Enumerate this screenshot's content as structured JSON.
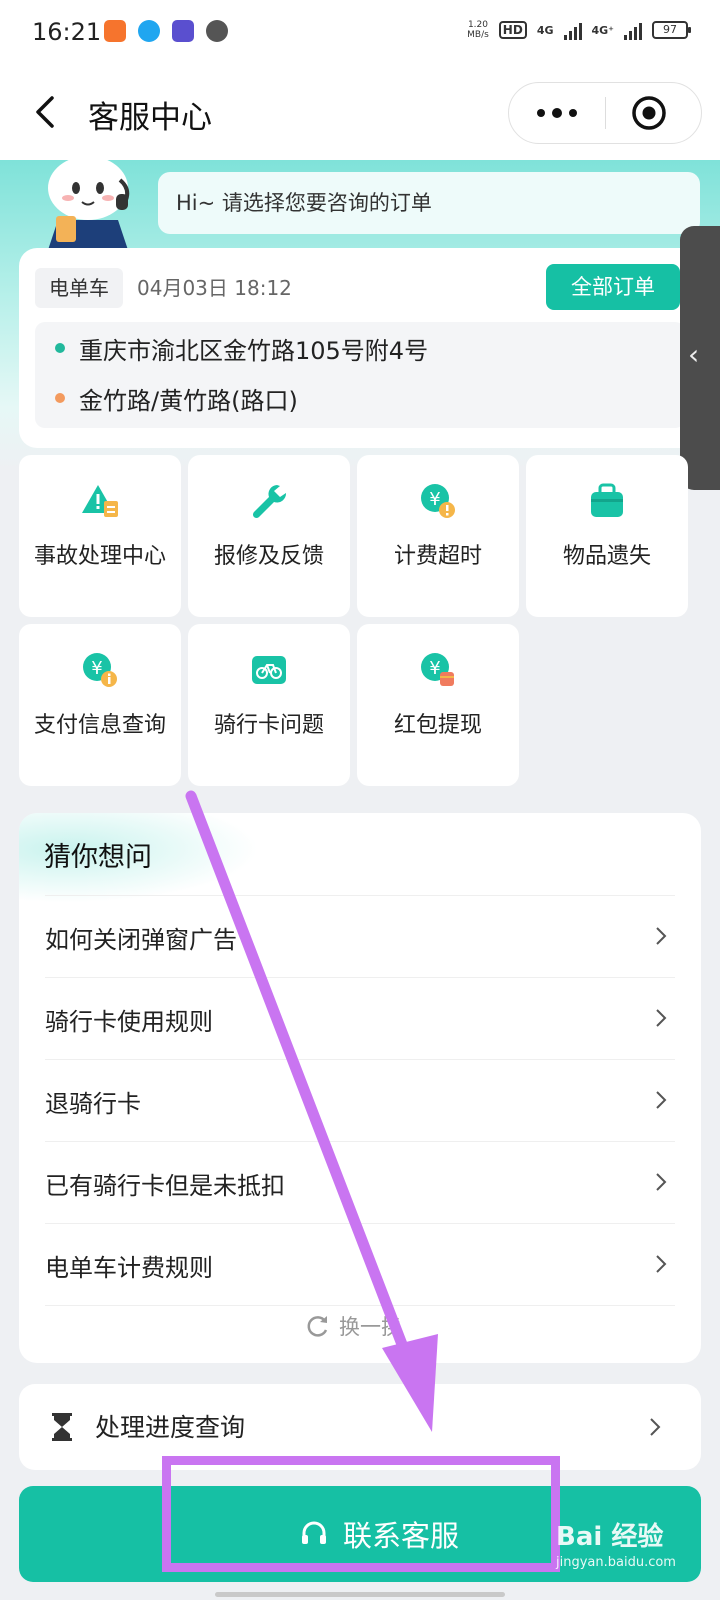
{
  "status_bar": {
    "time": "16:21",
    "net_speed_value": "1.20",
    "net_speed_unit": "MB/s",
    "hd_label": "HD",
    "signal1": "4G",
    "signal2": "4G⁺",
    "battery": "97"
  },
  "header": {
    "title": "客服中心"
  },
  "greeting": "Hi~ 请选择您要咨询的订单",
  "order": {
    "type_tag": "电单车",
    "time": "04月03日 18:12",
    "all_orders_label": "全部订单",
    "start_address": "重庆市渝北区金竹路105号附4号",
    "end_address": "金竹路/黄竹路(路口)"
  },
  "services": [
    {
      "label": "事故处理中心",
      "icon": "warning-icon"
    },
    {
      "label": "报修及反馈",
      "icon": "wrench-icon"
    },
    {
      "label": "计费超时",
      "icon": "yuan-coin-alert-icon"
    },
    {
      "label": "物品遗失",
      "icon": "bag-icon"
    },
    {
      "label": "支付信息查询",
      "icon": "yuan-coin-info-icon"
    },
    {
      "label": "骑行卡问题",
      "icon": "bike-card-icon"
    },
    {
      "label": "红包提现",
      "icon": "yuan-coin-redpacket-icon"
    }
  ],
  "guess": {
    "title": "猜你想问",
    "questions": [
      "如何关闭弹窗广告",
      "骑行卡使用规则",
      "退骑行卡",
      "已有骑行卡但是未抵扣",
      "电单车计费规则"
    ],
    "refresh_label": "换一换"
  },
  "progress_label": "处理进度查询",
  "contact_label": "联系客服",
  "watermark": {
    "brand": "Bai 经验",
    "site": "jingyan.baidu.com"
  },
  "colors": {
    "accent": "#16c0a4",
    "annotation": "#c975f1",
    "start_dot": "#21b89c",
    "end_dot": "#f39a5e"
  }
}
